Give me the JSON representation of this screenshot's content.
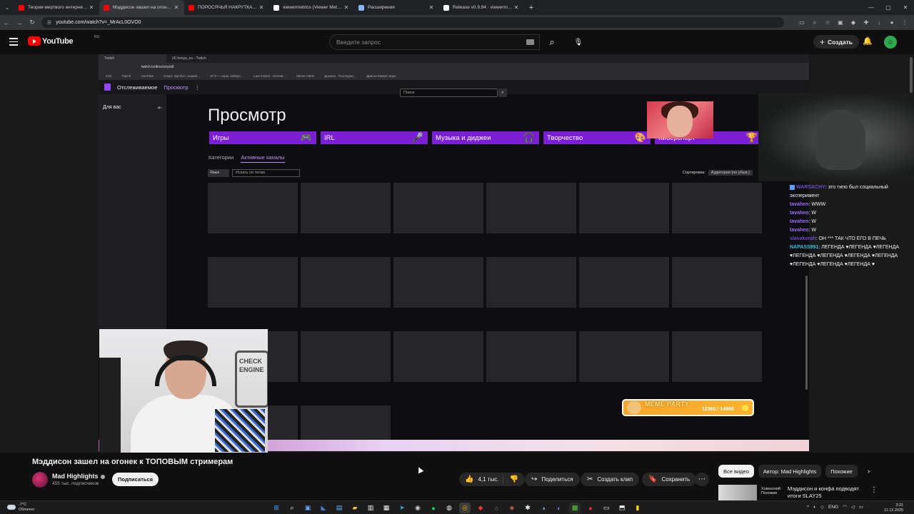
{
  "browser": {
    "tabs": [
      {
        "title": "Теория мертвого интернета к…",
        "color": "#ff0000",
        "active": false
      },
      {
        "title": "Мэддисон зашел на огон…",
        "color": "#ff0000",
        "active": true
      },
      {
        "title": "ПОРОСЯЧЬЯ НАКРУТКА ТВИЧ…",
        "color": "#ff0000",
        "active": false
      },
      {
        "title": "viewermetrics (Viewer Metrics)",
        "color": "#ffffff",
        "active": false
      },
      {
        "title": "Расширения",
        "color": "#8ab4f8",
        "active": false
      },
      {
        "title": "Release v0.9.94 · viewermetric…",
        "color": "#ffffff",
        "active": false
      }
    ],
    "url": "youtube.com/watch?v=_MrAcL0OVO0"
  },
  "youtube": {
    "logo_text": "YouTube",
    "region": "RU",
    "search_placeholder": "Введите запрос",
    "create_label": "Создать"
  },
  "stream": {
    "inner_tabs": [
      "Twitch",
      "(4) konya_eu - Twitch"
    ],
    "inner_url": "twitch.tv/directory/all",
    "bookmarks": [
      "Kick",
      "Twitch",
      "YouTube",
      "Спорт: футбол, хоккей…",
      "ЕГЭ — игры, киберс…",
      "Last Invites · Oxmetr…",
      "Meme Alerts",
      "Донаты · Последни…",
      "Драгон Мемес игры"
    ],
    "nav": {
      "following": "Отслеживаемое",
      "browse": "Просмотр",
      "search_placeholder": "Поиск"
    },
    "sidebar_label": "Для вас",
    "page_title": "Просмотр",
    "categories": [
      "Игры",
      "IRL",
      "Музыка и диджеи",
      "Творчество",
      "Киберспорт"
    ],
    "tabs": {
      "categories": "Категории",
      "live": "Активные каналы"
    },
    "filter": {
      "lang": "Язык",
      "tags_placeholder": "Искать по тегам"
    },
    "sort": {
      "label": "Сортировка:",
      "value": "Аудитория (по убыв.)"
    },
    "meme": {
      "label": "MEME PARTY",
      "count": "12360 / 14900"
    },
    "wall_sign": "CHECK ENGINE",
    "chat": [
      {
        "user": "WARSACHY",
        "text": "это типо был социальный эксперимент",
        "cls": "n3",
        "badge": true
      },
      {
        "user": "tavahen",
        "text": "WWW",
        "cls": "n1",
        "badge": false
      },
      {
        "user": "tavahen",
        "text": "W",
        "cls": "n1",
        "badge": false
      },
      {
        "user": "tavahen",
        "text": "W",
        "cls": "n1",
        "badge": false
      },
      {
        "user": "tavahen",
        "text": "W",
        "cls": "n1",
        "badge": false
      },
      {
        "user": "slavakorah",
        "text": "ОН *** ТАК ЧТО ЕГО В ПЕЧЬ",
        "cls": "n3",
        "badge": false
      },
      {
        "user": "NAPASS991",
        "text": "ЛЕГЕНДА ♥ЛЕГЕНДА ♥ЛЕГЕНДА ♥ЛЕГЕНДА ♥ЛЕГЕНДА ♥ЛЕГЕНДА ♥ЛЕГЕНДА ♥ЛЕГЕНДА ♥ЛЕГЕНДА ♥ЛЕГЕНДА ♥",
        "cls": "n4",
        "badge": false
      }
    ]
  },
  "video": {
    "title": "Мэддисон зашел на огонек к ТОПОВЫМ стримерам",
    "channel": "Mad Highlights",
    "subscribers": "455 тыс. подписчиков",
    "subscribe": "Подписаться",
    "likes": "4,1 тыс.",
    "share": "Поделиться",
    "clip": "Создать клип",
    "save": "Сохранить"
  },
  "recs": {
    "chips": [
      "Все видео",
      "Автор: Mad Highlights",
      "Похожие"
    ],
    "first": {
      "channel_badge": "Хованский Похожие",
      "title": "Мэддисон и конфа подводят итоги SLAY25"
    }
  },
  "taskbar": {
    "weather_temp": "-7°C",
    "weather_text": "Облачно",
    "lang": "ENG",
    "time": "3:21",
    "date": "11.12.2025"
  }
}
